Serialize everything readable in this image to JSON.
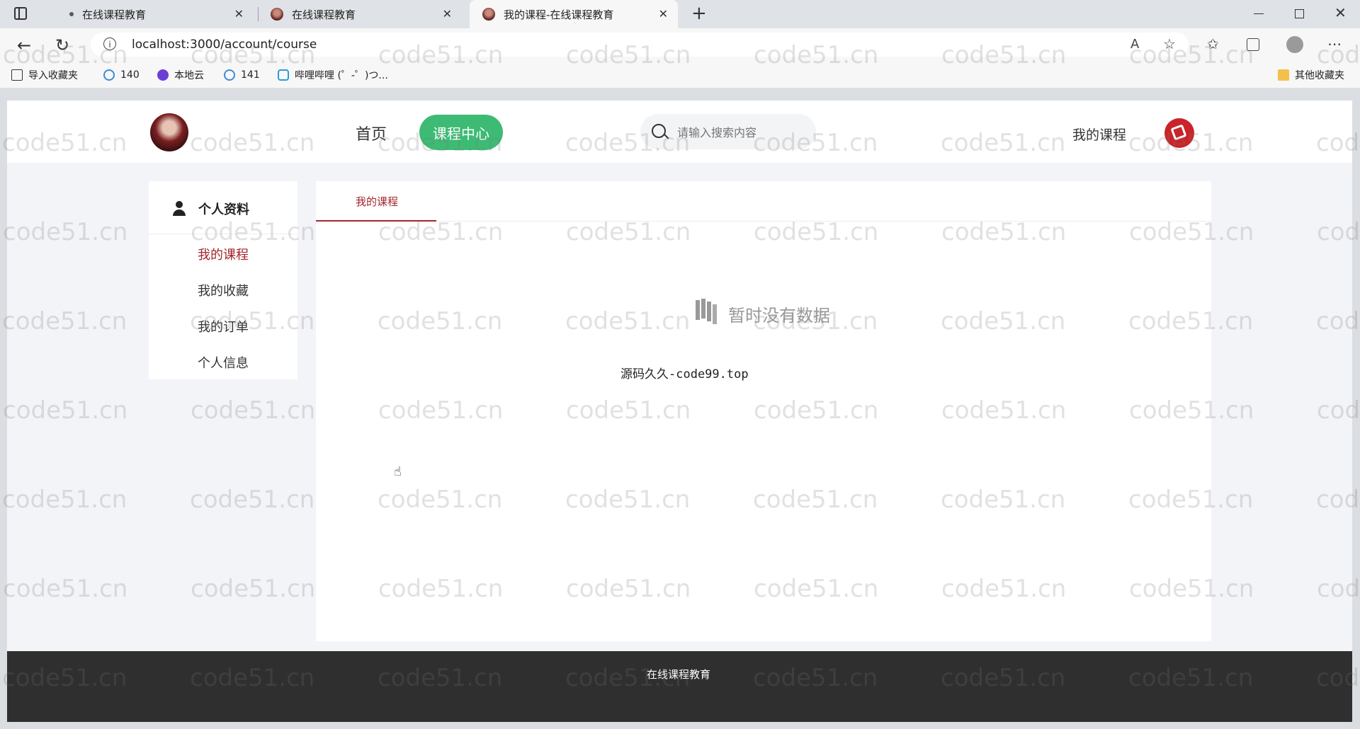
{
  "browser": {
    "tabs": [
      {
        "title": "在线课程教育"
      },
      {
        "title": "在线课程教育"
      },
      {
        "title": "我的课程-在线课程教育"
      }
    ],
    "new_tab_symbol": "+",
    "address": "localhost:3000/account/course",
    "bookmarks": [
      {
        "label": "导入收藏夹"
      },
      {
        "label": "140"
      },
      {
        "label": "本地云"
      },
      {
        "label": "141"
      },
      {
        "label": "哔哩哔哩 (゜-゜)つ..."
      }
    ],
    "other_bookmarks": "其他收藏夹"
  },
  "header": {
    "home": "首页",
    "course_center": "课程中心",
    "search_placeholder": "请输入搜索内容",
    "my_course": "我的课程"
  },
  "sidebar": {
    "title": "个人资料",
    "items": [
      {
        "label": "我的课程",
        "active": true
      },
      {
        "label": "我的收藏"
      },
      {
        "label": "我的订单"
      },
      {
        "label": "个人信息"
      }
    ]
  },
  "main": {
    "tab": "我的课程",
    "empty_text": "暂时没有数据",
    "source_note": "源码久久-code99.top"
  },
  "footer": {
    "text": "在线课程教育"
  },
  "watermark": "code51.cn",
  "colors": {
    "accent_red": "#a3262e",
    "green": "#3dbb74",
    "footer": "#2f2f2f"
  }
}
